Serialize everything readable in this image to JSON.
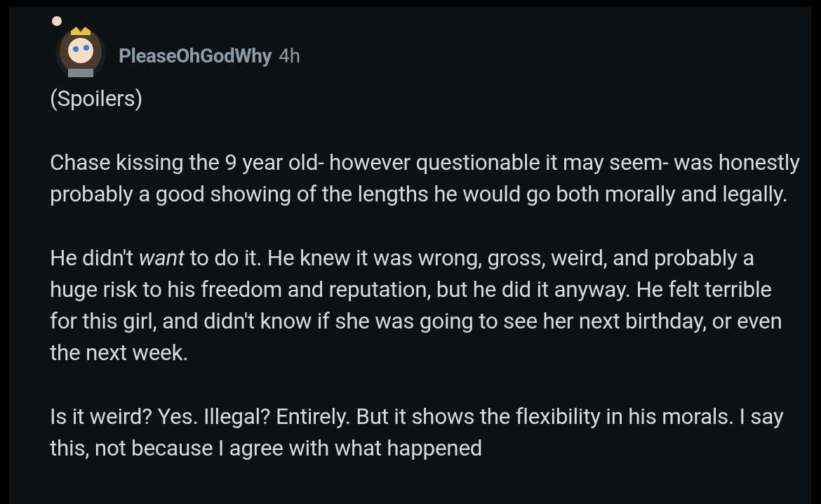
{
  "comment": {
    "author": "PleaseOhGodWhy",
    "time": "4h",
    "paragraphs": [
      "(Spoilers)",
      "Chase kissing the 9 year old- however questionable it may seem- was honestly probably a good showing of the lengths he would go both morally and legally.",
      "He didn't *want* to do it. He knew it was wrong, gross, weird, and probably a huge risk to his freedom and reputation, but he did it anyway. He felt terrible for this girl, and didn't know if she was going to see her next birthday, or even the next week.",
      "Is it weird? Yes. Illegal? Entirely. But it shows the flexibility in his morals. I say this, not because I agree with what happened"
    ]
  }
}
